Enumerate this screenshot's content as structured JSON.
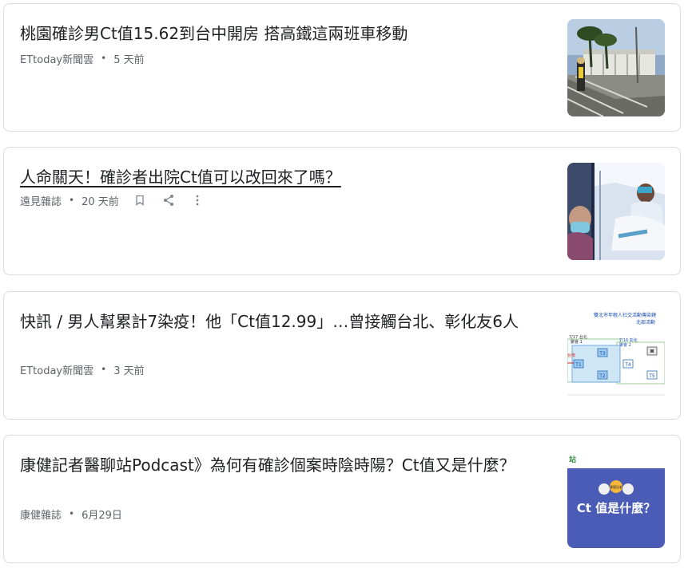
{
  "articles": [
    {
      "title": "桃園確診男Ct值15.62到台中開房 搭高鐵這兩班車移動",
      "source": "ETtoday新聞雲",
      "time": "5 天前"
    },
    {
      "title": "人命關天！確診者出院Ct值可以改回來了嗎？",
      "source": "遠見雜誌",
      "time": "20 天前"
    },
    {
      "title": "快訊 / 男人幫累計7染疫！他「Ct值12.99」…曾接觸台北、彰化友6人",
      "source": "ETtoday新聞雲",
      "time": "3 天前",
      "thumb_text": {
        "header": "雙北市年輕人社交活動傳染鏈",
        "sub": "北部活動",
        "d1": "7/17 台北",
        "d2": "7/16 彰化",
        "d1b": "聚會 1",
        "d2b": "聚會 2",
        "t1": "T1",
        "t2": "T2",
        "t3": "T3",
        "t4": "T4",
        "t5": "T5",
        "side": "台南"
      }
    },
    {
      "title": "康健記者醫聊站Podcast》為何有確診個案時陰時陽？Ct值又是什麼？",
      "source": "康健雜誌",
      "time": "6月29日",
      "thumb_text": {
        "top": "站",
        "badge": "康健記者",
        "main": "Ct 值是什麼？"
      }
    }
  ],
  "colors": {
    "text": "#202124",
    "meta": "#5f6368",
    "border": "#dadce0",
    "podcast_blue": "#4a5cb5"
  },
  "icons": [
    "bookmark-icon",
    "share-icon",
    "more-vert-icon"
  ]
}
